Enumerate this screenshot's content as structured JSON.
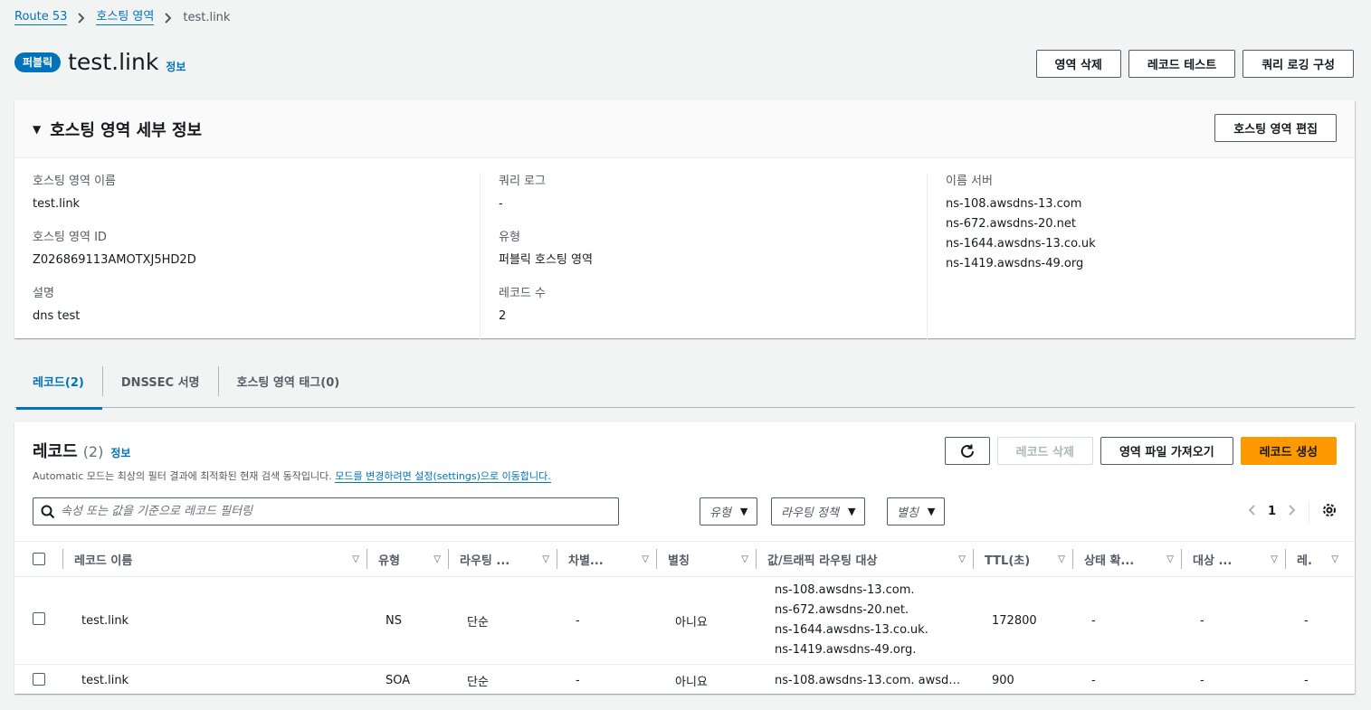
{
  "breadcrumb": {
    "items": [
      "Route 53",
      "호스팅 영역"
    ],
    "current": "test.link"
  },
  "header": {
    "badge": "퍼블릭",
    "title": "test.link",
    "info": "정보",
    "buttons": [
      "영역 삭제",
      "레코드 테스트",
      "쿼리 로깅 구성"
    ]
  },
  "details": {
    "title": "호스팅 영역 세부 정보",
    "edit_button": "호스팅 영역 편집",
    "col1": [
      {
        "k": "호스팅 영역 이름",
        "v": "test.link"
      },
      {
        "k": "호스팅 영역 ID",
        "v": "Z026869113AMOTXJ5HD2D"
      },
      {
        "k": "설명",
        "v": "dns test"
      }
    ],
    "col2": [
      {
        "k": "쿼리 로그",
        "v": "-"
      },
      {
        "k": "유형",
        "v": "퍼블릭 호스팅 영역"
      },
      {
        "k": "레코드 수",
        "v": "2"
      }
    ],
    "name_servers_label": "이름 서버",
    "name_servers": [
      "ns-108.awsdns-13.com",
      "ns-672.awsdns-20.net",
      "ns-1644.awsdns-13.co.uk",
      "ns-1419.awsdns-49.org"
    ]
  },
  "tabs": [
    "레코드(2)",
    "DNSSEC 서명",
    "호스팅 영역 태그(0)"
  ],
  "records": {
    "title": "레코드",
    "count": "(2)",
    "info": "정보",
    "desc": "Automatic 모드는 최상의 필터 결과에 최적화된 현재 검색 동작입니다.",
    "desc_link": "모드를 변경하려면 설정(settings)으로 이동합니다.",
    "buttons": {
      "delete": "레코드 삭제",
      "import": "영역 파일 가져오기",
      "create": "레코드 생성"
    },
    "search_placeholder": "속성 또는 값을 기준으로 레코드 필터링",
    "filters": [
      "유형",
      "라우팅 정책",
      "별칭"
    ],
    "page": "1",
    "columns": [
      "레코드 이름",
      "유형",
      "라우팅 ...",
      "차별...",
      "별칭",
      "값/트래픽 라우팅 대상",
      "TTL(초)",
      "상태 확...",
      "대상 ...",
      "레."
    ],
    "rows": [
      {
        "name": "test.link",
        "type": "NS",
        "routing": "단순",
        "diff": "-",
        "alias": "아니요",
        "values": [
          "ns-108.awsdns-13.com.",
          "ns-672.awsdns-20.net.",
          "ns-1644.awsdns-13.co.uk.",
          "ns-1419.awsdns-49.org."
        ],
        "ttl": "172800",
        "health": "-",
        "target": "-",
        "rec": "-"
      },
      {
        "name": "test.link",
        "type": "SOA",
        "routing": "단순",
        "diff": "-",
        "alias": "아니요",
        "values": [
          "ns-108.awsdns-13.com. awsd…"
        ],
        "ttl": "900",
        "health": "-",
        "target": "-",
        "rec": "-"
      }
    ]
  },
  "colors": {
    "accent": "#0073bb",
    "primary_button": "#ff9900"
  }
}
